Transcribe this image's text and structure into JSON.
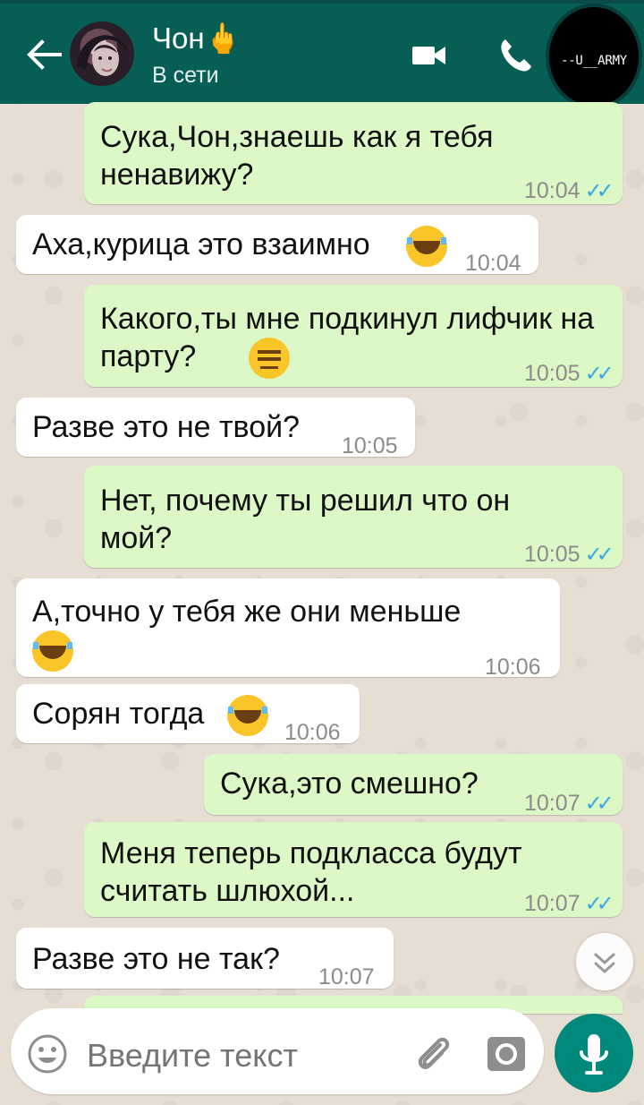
{
  "header": {
    "contact_name": "Чон🖕",
    "status": "В сети",
    "watermark": "--U__ARMY"
  },
  "messages": [
    {
      "direction": "outgoing",
      "text": "Сука,Чон,знаешь как я тебя ненавижу?",
      "time": "10:04",
      "status": "read"
    },
    {
      "direction": "incoming",
      "text": "Аха,курица это взаимно",
      "emoji": "laughing",
      "time": "10:04"
    },
    {
      "direction": "outgoing",
      "text": "Какого,ты мне подкинул лифчик на парту?",
      "emoji": "neutral",
      "time": "10:05",
      "status": "read"
    },
    {
      "direction": "incoming",
      "text": "Разве это не твой?",
      "time": "10:05"
    },
    {
      "direction": "outgoing",
      "text": "Нет, почему ты решил что он мой?",
      "time": "10:05",
      "status": "read"
    },
    {
      "direction": "incoming",
      "text": "А,точно у тебя же они меньше",
      "emoji": "laughing",
      "time": "10:06"
    },
    {
      "direction": "incoming",
      "text": "Сорян тогда",
      "emoji": "laughing",
      "time": "10:06"
    },
    {
      "direction": "outgoing",
      "text": "Сука,это смешно?",
      "time": "10:07",
      "status": "read"
    },
    {
      "direction": "outgoing",
      "text": "Меня теперь подкласса будут считать шлюхой...",
      "time": "10:07",
      "status": "read"
    },
    {
      "direction": "incoming",
      "text": "Разве это не так?",
      "time": "10:07"
    }
  ],
  "composer": {
    "placeholder": "Введите текст"
  },
  "icons": {
    "back": "arrow-left-icon",
    "video": "video-camera-icon",
    "phone": "phone-icon",
    "emoji": "emoji-icon",
    "attach": "paperclip-icon",
    "camera": "camera-icon",
    "microphone": "microphone-icon",
    "scroll": "chevron-double-down-icon"
  },
  "colors": {
    "header": "#075e54",
    "incoming_bubble": "#ffffff",
    "outgoing_bubble": "#dcf8c6",
    "read_ticks": "#38a8e5",
    "mic_button": "#00897b"
  }
}
